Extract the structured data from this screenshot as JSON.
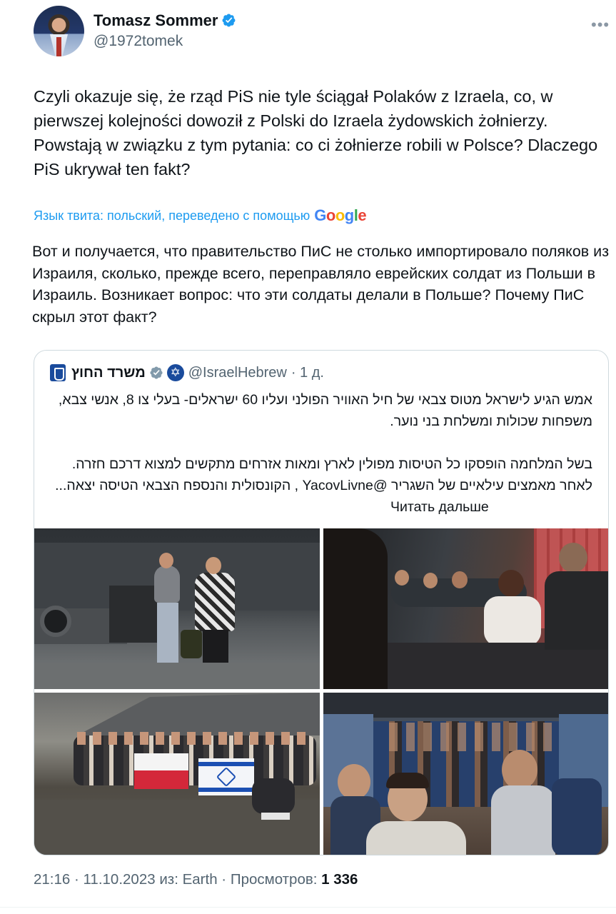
{
  "author": {
    "display_name": "Tomasz Sommer",
    "handle": "@1972tomek"
  },
  "tweet": {
    "text": "Czyli okazuje się, że rząd PiS nie tyle ściągał Polaków z Izraela, co, w pierwszej kolejności dowoził z Polski do Izraela żydowskich żołnierzy. Powstają w związku z tym pytania: co ci żołnierze robili w Polsce? Dlaczego PiS ukrywał ten fakt?",
    "translation_label": "Язык твита: польский, переведено с помощью",
    "translation_provider": "Google",
    "translated_text": "Вот и получается, что правительство ПиС не столько импортировало поляков из Израиля, сколько, прежде всего, переправляло еврейских солдат из Польши в Израиль. Возникает вопрос: что эти солдаты делали в Польше? Почему ПиС скрыл этот факт?"
  },
  "quoted_tweet": {
    "name": "משרד החוץ",
    "handle": "@IsraelHebrew",
    "time": "· 1 д.",
    "paragraph_1": "אמש הגיע לישראל מטוס צבאי של חיל האוויר הפולני ועליו 60 ישראלים- בעלי צו 8, אנשי צבא, משפחות שכולות ומשלחת בני נוער.",
    "paragraph_2": "בשל המלחמה הופסקו כל הטיסות מפולין לארץ ומאות אזרחים מתקשים למצוא דרכם חזרה. לאחר מאמצים עילאיים של השגריר @YacovLivne , הקונסולית והנספח הצבאי הטיסה יצאה...",
    "read_more": "Читать дальше",
    "photos": [
      "photo-plane-arrival",
      "photo-plane-cabin",
      "photo-group-flags",
      "photo-bus-passengers"
    ]
  },
  "footer": {
    "time": "21:16",
    "date": "11.10.2023",
    "source_prefix": "из:",
    "source": "Earth",
    "views_label": "Просмотров:",
    "views": "1 336"
  },
  "colors": {
    "link": "#1d9bf0",
    "verified": "#1d9bf0",
    "secondary_text": "#536471",
    "border": "#cfd9de"
  }
}
